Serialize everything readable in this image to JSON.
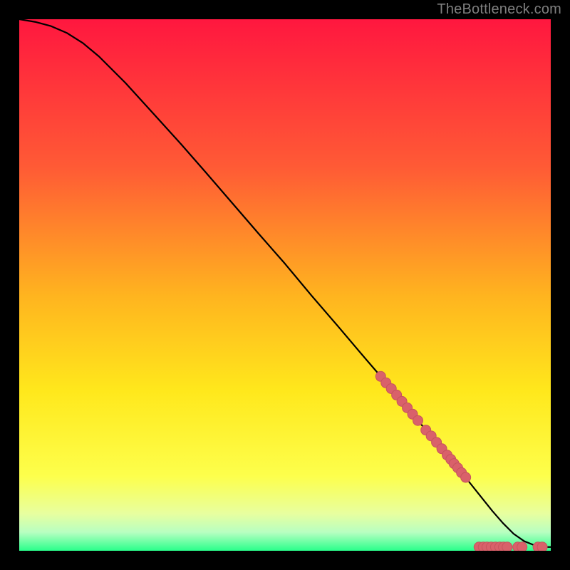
{
  "watermark": "TheBottleneck.com",
  "colors": {
    "curve": "#000000",
    "marker_fill": "#d9616a",
    "marker_stroke": "#c6545d",
    "gradient_top": "#ff173f",
    "gradient_mid1": "#ff5b35",
    "gradient_mid2": "#ffb41f",
    "gradient_mid3": "#ffe81c",
    "gradient_mid4": "#fdff4c",
    "gradient_mid5": "#e8ff9f",
    "gradient_mid6": "#b8ffc1",
    "gradient_bottom": "#2aff8b"
  },
  "chart_data": {
    "type": "line",
    "title": "",
    "xlabel": "",
    "ylabel": "",
    "xlim": [
      0,
      100
    ],
    "ylim": [
      0,
      100
    ],
    "series": [
      {
        "name": "curve",
        "x": [
          0,
          3,
          6,
          9,
          12,
          15,
          20,
          25,
          30,
          35,
          40,
          45,
          50,
          55,
          60,
          65,
          70,
          75,
          80,
          83,
          85,
          87,
          89,
          91,
          93,
          95,
          97,
          99,
          100
        ],
        "y": [
          100,
          99.5,
          98.7,
          97.4,
          95.5,
          93.0,
          88.0,
          82.5,
          77.0,
          71.3,
          65.5,
          59.7,
          54.0,
          48.0,
          42.2,
          36.3,
          30.5,
          24.5,
          18.6,
          15.0,
          12.5,
          10.0,
          7.5,
          5.2,
          3.2,
          1.8,
          1.0,
          0.7,
          0.7
        ]
      }
    ],
    "markers": [
      {
        "x": 68.0,
        "y": 32.8
      },
      {
        "x": 69.0,
        "y": 31.6
      },
      {
        "x": 70.0,
        "y": 30.5
      },
      {
        "x": 71.0,
        "y": 29.3
      },
      {
        "x": 72.0,
        "y": 28.1
      },
      {
        "x": 73.0,
        "y": 26.9
      },
      {
        "x": 74.0,
        "y": 25.7
      },
      {
        "x": 75.0,
        "y": 24.5
      },
      {
        "x": 76.5,
        "y": 22.7
      },
      {
        "x": 77.5,
        "y": 21.6
      },
      {
        "x": 78.5,
        "y": 20.4
      },
      {
        "x": 79.5,
        "y": 19.2
      },
      {
        "x": 80.5,
        "y": 18.0
      },
      {
        "x": 81.2,
        "y": 17.2
      },
      {
        "x": 81.8,
        "y": 16.4
      },
      {
        "x": 82.5,
        "y": 15.6
      },
      {
        "x": 83.2,
        "y": 14.7
      },
      {
        "x": 84.0,
        "y": 13.8
      },
      {
        "x": 86.5,
        "y": 0.7
      },
      {
        "x": 87.3,
        "y": 0.7
      },
      {
        "x": 88.0,
        "y": 0.7
      },
      {
        "x": 88.8,
        "y": 0.7
      },
      {
        "x": 89.6,
        "y": 0.7
      },
      {
        "x": 90.4,
        "y": 0.7
      },
      {
        "x": 91.1,
        "y": 0.7
      },
      {
        "x": 91.8,
        "y": 0.7
      },
      {
        "x": 93.8,
        "y": 0.7
      },
      {
        "x": 94.6,
        "y": 0.7
      },
      {
        "x": 97.6,
        "y": 0.7
      },
      {
        "x": 98.4,
        "y": 0.7
      }
    ]
  }
}
